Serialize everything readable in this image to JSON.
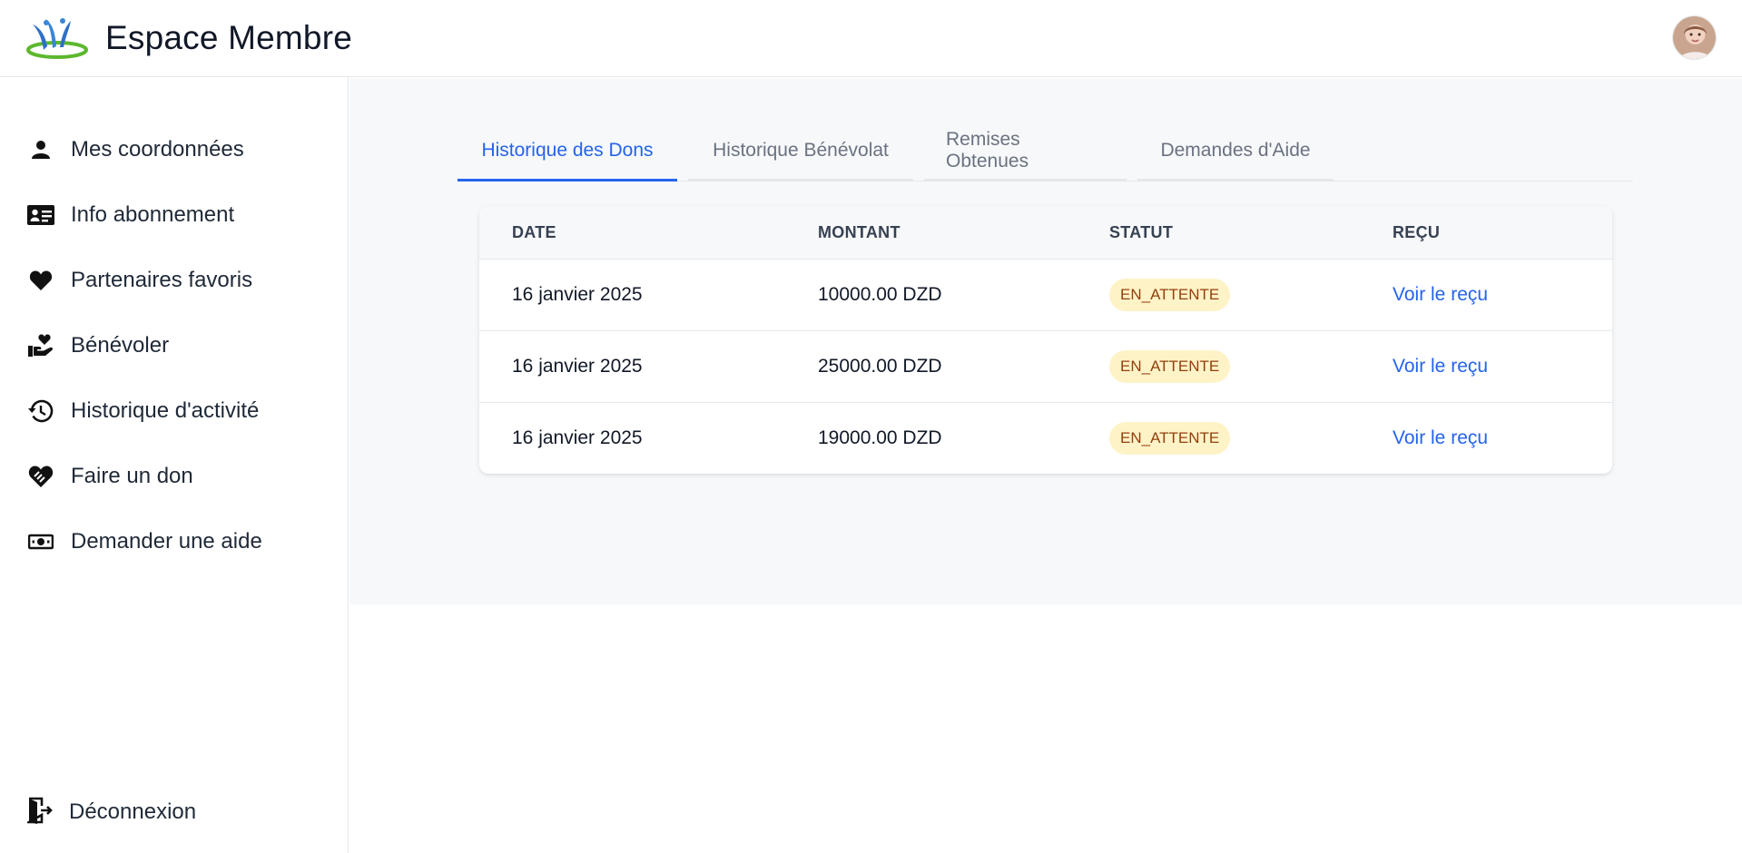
{
  "header": {
    "title": "Espace Membre",
    "logo_icon": "brand-logo-icon",
    "avatar_icon": "user-avatar"
  },
  "sidebar": {
    "items": [
      {
        "label": "Mes coordonnées",
        "icon": "person-icon"
      },
      {
        "label": "Info abonnement",
        "icon": "id-card-icon"
      },
      {
        "label": "Partenaires favoris",
        "icon": "heart-icon"
      },
      {
        "label": "Bénévoler",
        "icon": "hand-heart-icon"
      },
      {
        "label": "Historique d'activité",
        "icon": "history-icon"
      },
      {
        "label": "Faire un don",
        "icon": "handshake-heart-icon"
      },
      {
        "label": "Demander une aide",
        "icon": "money-icon"
      }
    ],
    "logout": {
      "label": "Déconnexion",
      "icon": "logout-icon"
    }
  },
  "tabs": [
    {
      "label": "Historique des Dons",
      "active": true
    },
    {
      "label": "Historique Bénévolat",
      "active": false
    },
    {
      "label": "Remises Obtenues",
      "active": false
    },
    {
      "label": "Demandes d'Aide",
      "active": false
    }
  ],
  "table": {
    "columns": [
      "DATE",
      "MONTANT",
      "STATUT",
      "REÇU"
    ],
    "rows": [
      {
        "date": "16 janvier 2025",
        "amount": "10000.00 DZD",
        "status": "EN_ATTENTE",
        "receipt": "Voir le reçu"
      },
      {
        "date": "16 janvier 2025",
        "amount": "25000.00 DZD",
        "status": "EN_ATTENTE",
        "receipt": "Voir le reçu"
      },
      {
        "date": "16 janvier 2025",
        "amount": "19000.00 DZD",
        "status": "EN_ATTENTE",
        "receipt": "Voir le reçu"
      }
    ]
  },
  "colors": {
    "accent": "#2563eb",
    "badge_bg": "#fef3c7",
    "badge_text": "#92400e",
    "main_bg": "#f6f8fa"
  }
}
